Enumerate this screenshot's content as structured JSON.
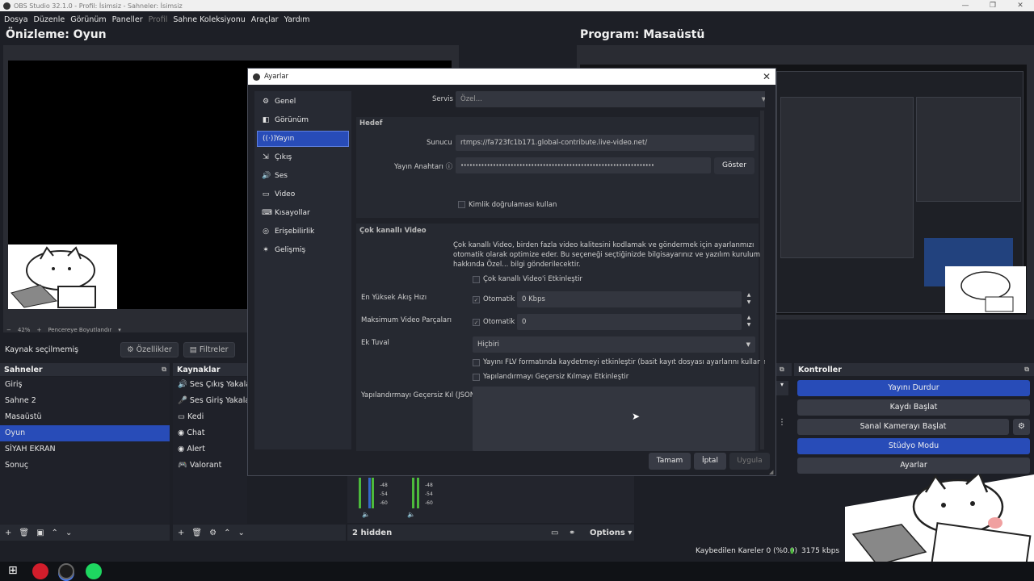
{
  "window": {
    "title": "OBS Studio 32.1.0 - Profil: İsimsiz - Sahneler: İsimsiz",
    "min": "—",
    "max": "❐",
    "close": "✕"
  },
  "menu": [
    "Dosya",
    "Düzenle",
    "Görünüm",
    "Paneller",
    "Profil",
    "Sahne Koleksiyonu",
    "Araçlar",
    "Yardım"
  ],
  "preview": {
    "title": "Önizleme: Oyun",
    "zoom": "42%",
    "fit": "Pencereye Boyutlandır"
  },
  "program": {
    "title": "Program: Masaüstü"
  },
  "sourcebar": {
    "none": "Kaynak seçilmemiş",
    "properties": "Özellikler",
    "filters": "Filtreler"
  },
  "scenes": {
    "title": "Sahneler",
    "items": [
      "Giriş",
      "Sahne 2",
      "Masaüstü",
      "Oyun",
      "SİYAH EKRAN",
      "Sonuç"
    ],
    "selected_index": 3
  },
  "sources": {
    "title": "Kaynaklar",
    "items": [
      {
        "icon": "speaker-icon",
        "label": "Ses Çıkış Yakalayıcı"
      },
      {
        "icon": "microphone-icon",
        "label": "Ses Giriş Yakalayıcı"
      },
      {
        "icon": "image-icon",
        "label": "Kedi"
      },
      {
        "icon": "browser-icon",
        "label": "Chat"
      },
      {
        "icon": "browser-icon",
        "label": "Alert"
      },
      {
        "icon": "game-icon",
        "label": "Valorant"
      }
    ]
  },
  "mixer": {
    "hidden": "2 hidden",
    "options": "Options",
    "ticks": [
      "-48",
      "-54",
      "-60"
    ]
  },
  "controls": {
    "title": "Kontroller",
    "stop_stream": "Yayını Durdur",
    "start_record": "Kaydı Başlat",
    "virtual_cam": "Sanal Kamerayı Başlat",
    "studio": "Stüdyo Modu",
    "settings": "Ayarlar"
  },
  "status": {
    "dropped": "Kaybedilen Kareler 0 (%0.0)",
    "bitrate": "3175 kbps"
  },
  "dialog": {
    "title": "Ayarlar",
    "sidebar": [
      {
        "icon": "gear-icon",
        "label": "Genel"
      },
      {
        "icon": "appearance-icon",
        "label": "Görünüm"
      },
      {
        "icon": "broadcast-icon",
        "label": "Yayın"
      },
      {
        "icon": "output-icon",
        "label": "Çıkış"
      },
      {
        "icon": "audio-icon",
        "label": "Ses"
      },
      {
        "icon": "monitor-icon",
        "label": "Video"
      },
      {
        "icon": "keyboard-icon",
        "label": "Kısayollar"
      },
      {
        "icon": "accessibility-icon",
        "label": "Erişebilirlik"
      },
      {
        "icon": "wrench-icon",
        "label": "Gelişmiş"
      }
    ],
    "selected_index": 2,
    "service_label": "Servis",
    "service_value": "Özel...",
    "dest_title": "Hedef",
    "server_label": "Sunucu",
    "server_value": "rtmps://fa723fc1b171.global-contribute.live-video.net/",
    "key_label": "Yayın Anahtarı",
    "key_value": "••••••••••••••••••••••••••••••••••••••••••••••••••••••••••••••••••",
    "show_button": "Göster",
    "auth_label": "Kimlik doğrulaması kullan",
    "multi_title": "Çok kanallı Video",
    "multi_desc1": "Çok kanallı Video, birden fazla video kalitesini kodlamak ve göndermek için ayarlanmızı",
    "multi_desc2": "otomatik olarak optimize eder. Bu seçeneği seçtiğinizde bilgisayarınız ve yazılım kurulumunuz",
    "multi_desc3": "hakkında Özel... bilgi gönderilecektir.",
    "multi_enable": "Çok kanallı Video'i Etkinleştir",
    "max_bitrate_label": "En Yüksek Akış Hızı",
    "auto_label": "Otomatik",
    "max_bitrate_value": "0 Kbps",
    "max_parts_label": "Maksimum Video Parçaları",
    "max_parts_value": "0",
    "extra_canvas_label": "Ek Tuval",
    "extra_canvas_value": "Hiçbiri",
    "flv_label": "Yayını FLV formatında kaydetmeyi etkinleştir (basit kayıt dosyası ayarlarını kullanır)",
    "override_enable": "Yapılandırmayı Geçersiz Kılmayı Etkinleştir",
    "override_json_label": "Yapılandırmayı Geçersiz Kıl (JSON)",
    "ok": "Tamam",
    "cancel": "İptal",
    "apply": "Uygula"
  }
}
